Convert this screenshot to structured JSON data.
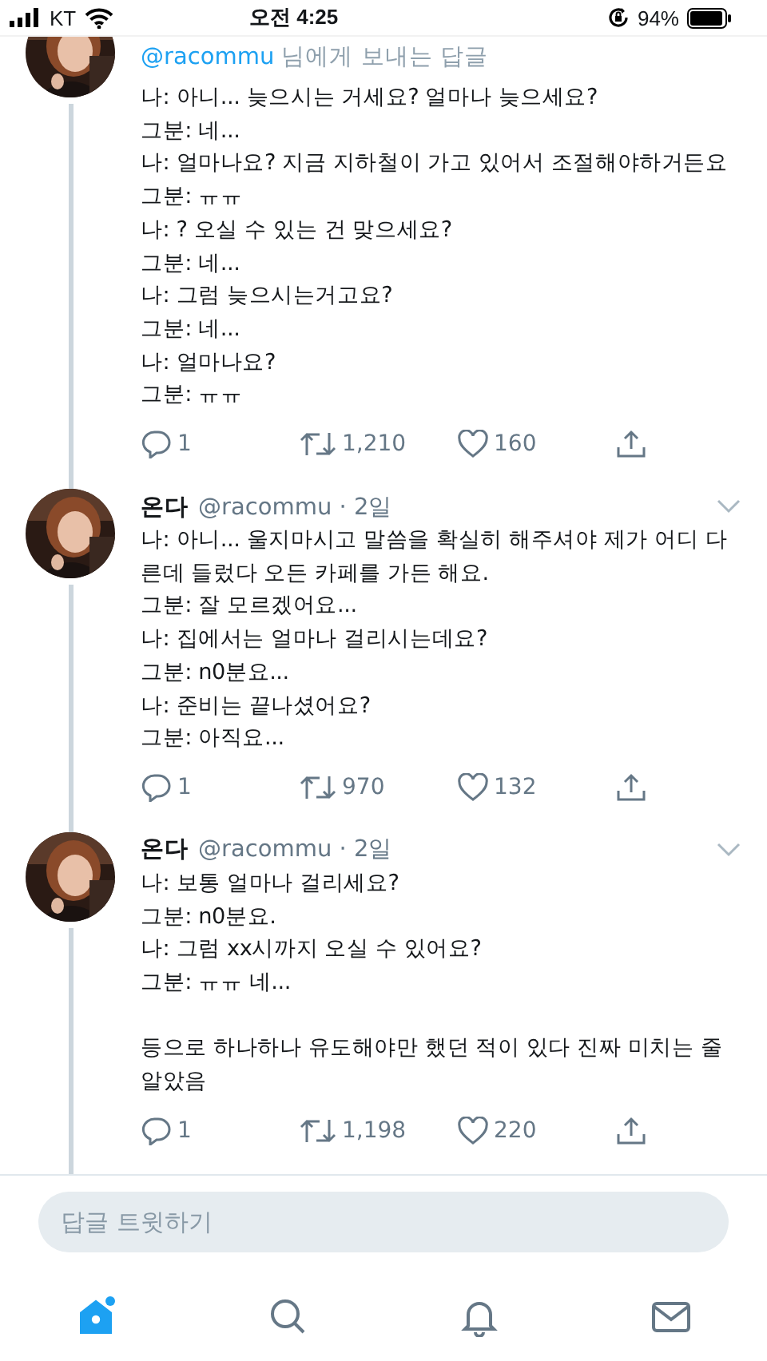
{
  "status_bar": {
    "carrier": "KT",
    "time": "오전 4:25",
    "battery": "94%"
  },
  "tweets": [
    {
      "reply_to": {
        "mention": "@racommu",
        "suffix": " 님에게 보내는 답글"
      },
      "lines": [
        "나: 아니... 늦으시는 거세요? 얼마나 늦으세요?",
        "그분: 네...",
        "나: 얼마나요? 지금 지하철이 가고 있어서 조절해야하거든요",
        "그분: ㅠㅠ",
        "나: ? 오실 수 있는 건 맞으세요?",
        "그분: 네...",
        "나: 그럼 늦으시는거고요?",
        "그분: 네...",
        "나: 얼마나요?",
        "그분: ㅠㅠ"
      ],
      "replies": "1",
      "retweets": "1,210",
      "likes": "160"
    },
    {
      "name": "온다",
      "handle": "@racommu · 2일",
      "lines": [
        "나: 아니... 울지마시고 말씀을 확실히 해주셔야 제가 어디 다른데 들렀다 오든 카페를 가든 해요.",
        "그분: 잘 모르겠어요...",
        "나: 집에서는 얼마나 걸리시는데요?",
        "그분: n0분요...",
        "나: 준비는 끝나셨어요?",
        "그분: 아직요..."
      ],
      "replies": "1",
      "retweets": "970",
      "likes": "132"
    },
    {
      "name": "온다",
      "handle": "@racommu · 2일",
      "lines": [
        "나: 보통 얼마나 걸리세요?",
        "그분: n0분요.",
        "나: 그럼 xx시까지 오실 수 있어요?",
        "그분: ㅠㅠ 네..."
      ],
      "postscript": "등으로 하나하나 유도해야만 했던 적이 있다 진짜 미치는 줄 알았음",
      "replies": "1",
      "retweets": "1,198",
      "likes": "220"
    }
  ],
  "reply_box": {
    "placeholder": "답글 트윗하기"
  },
  "tab_bar": [
    {
      "kind": "home",
      "selected": true,
      "badge": true
    },
    {
      "kind": "search",
      "selected": false,
      "badge": false
    },
    {
      "kind": "notifications",
      "selected": false,
      "badge": false
    },
    {
      "kind": "messages",
      "selected": false,
      "badge": false
    }
  ]
}
